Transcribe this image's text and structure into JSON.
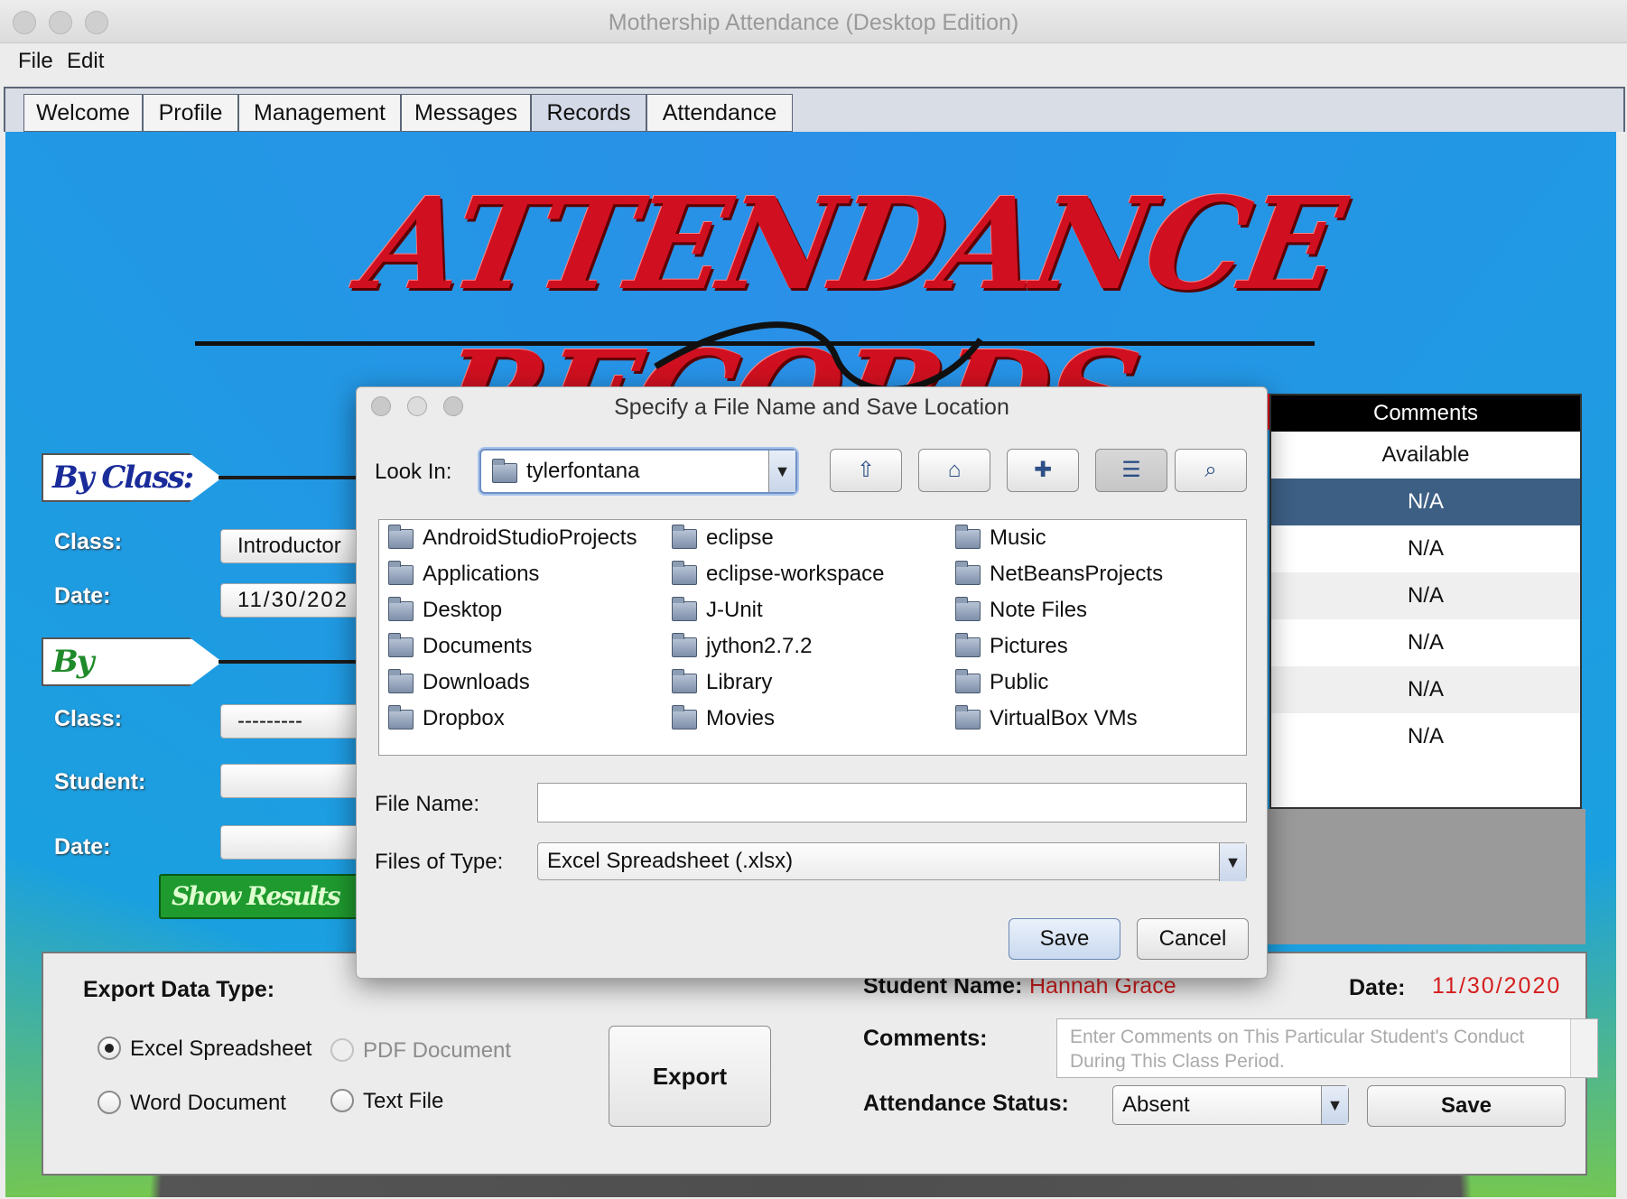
{
  "window": {
    "title": "Mothership Attendance (Desktop Edition)"
  },
  "menu": [
    "File",
    "Edit"
  ],
  "tabs": [
    "Welcome",
    "Profile",
    "Management",
    "Messages",
    "Records",
    "Attendance"
  ],
  "active_tab": "Records",
  "hero": {
    "title": "ATTENDANCE RECORDS"
  },
  "by_class": {
    "banner": "By Class:",
    "class_label": "Class:",
    "class_value": "Introductor",
    "date_label": "Date:",
    "date_value": "11/30/202"
  },
  "by_student": {
    "banner": "By Student:",
    "class_label": "Class:",
    "class_value": "---------",
    "student_label": "Student:",
    "date_label": "Date:",
    "show_button": "Show Results"
  },
  "table": {
    "header": "Comments",
    "rows": [
      "Available",
      "N/A",
      "N/A",
      "N/A",
      "N/A",
      "N/A",
      "N/A"
    ],
    "selected_index": 1
  },
  "export": {
    "title": "Export Data Type:",
    "options": [
      {
        "label": "Excel Spreadsheet",
        "checked": true,
        "enabled": true
      },
      {
        "label": "PDF Document",
        "checked": false,
        "enabled": false
      },
      {
        "label": "Word Document",
        "checked": false,
        "enabled": true
      },
      {
        "label": "Text File",
        "checked": false,
        "enabled": true
      }
    ],
    "button": "Export"
  },
  "student_panel": {
    "name_label": "Student Name:",
    "name_value": "Hannah Grace",
    "date_label": "Date:",
    "date_value": "11/30/2020",
    "comments_label": "Comments:",
    "comments_placeholder": "Enter Comments on This Particular Student's Conduct During This Class Period.",
    "status_label": "Attendance Status:",
    "status_value": "Absent",
    "save_button": "Save"
  },
  "dialog": {
    "title": "Specify a File Name and Save Location",
    "look_in_label": "Look In:",
    "look_in_value": "tylerfontana",
    "tools": [
      "up-folder-icon",
      "home-icon",
      "new-folder-icon",
      "list-view-icon",
      "details-view-icon"
    ],
    "files": [
      "AndroidStudioProjects",
      "Applications",
      "Desktop",
      "Documents",
      "Downloads",
      "Dropbox",
      "eclipse",
      "eclipse-workspace",
      "J-Unit",
      "jython2.7.2",
      "Library",
      "Movies",
      "Music",
      "NetBeansProjects",
      "Note Files",
      "Pictures",
      "Public",
      "VirtualBox VMs"
    ],
    "file_name_label": "File Name:",
    "file_name_value": "",
    "files_of_type_label": "Files of Type:",
    "files_of_type_value": "Excel Spreadsheet (.xlsx)",
    "save_button": "Save",
    "cancel_button": "Cancel"
  }
}
